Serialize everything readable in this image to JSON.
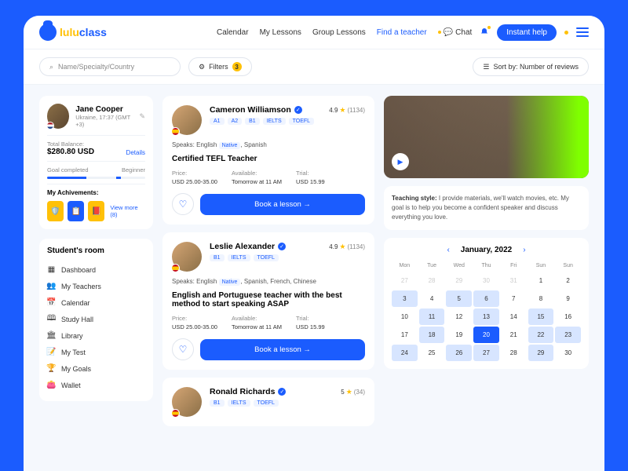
{
  "logo": {
    "part1": "lulu",
    "part2": "class"
  },
  "nav": [
    "Calendar",
    "My Lessons",
    "Group Lessons",
    "Find a teacher"
  ],
  "nav_active": 3,
  "chat_label": "Chat",
  "help_label": "Instant help",
  "search": {
    "placeholder": "Name/Specialty/Country"
  },
  "filters": {
    "label": "Filters",
    "count": "3"
  },
  "sort": {
    "label": "Sort by: Number of reviews"
  },
  "profile": {
    "name": "Jane Cooper",
    "location": "Ukraine, 17:37 (GMT +3)",
    "balance_label": "Total Balance:",
    "balance": "$280.80 USD",
    "details": "Details",
    "goal_label": "Goal completed",
    "goal_level": "Beginner",
    "ach_label": "My Achivements:",
    "viewmore": "View more (8)"
  },
  "menu": {
    "title": "Student's room",
    "items": [
      "Dashboard",
      "My Teachers",
      "Calendar",
      "Study Hall",
      "Library",
      "My Test",
      "My Goals",
      "Wallet"
    ]
  },
  "teachers": [
    {
      "name": "Cameron Williamson",
      "rating": "4.9",
      "reviews": "(1134)",
      "tags": [
        "A1",
        "A2",
        "B1",
        "IELTS",
        "TOEFL"
      ],
      "speaks_label": "Speaks:",
      "speaks": "English",
      "native": "Native",
      "speaks2": ", Spanish",
      "title": "Certified TEFL Teacher",
      "price_label": "Price:",
      "price": "USD 25.00-35.00",
      "avail_label": "Available:",
      "avail": "Tomorrow at 11 AM",
      "trial_label": "Trial:",
      "trial": "USD 15.99",
      "book": "Book a lesson →"
    },
    {
      "name": "Leslie Alexander",
      "rating": "4.9",
      "reviews": "(1134)",
      "tags": [
        "B1",
        "IELTS",
        "TOEFL"
      ],
      "speaks_label": "Speaks:",
      "speaks": "English",
      "native": "Native",
      "speaks2": ", Spanish, French, Chinese",
      "title": "English and Portuguese teacher with the best method to start speaking ASAP",
      "price_label": "Price:",
      "price": "USD 25.00-35.00",
      "avail_label": "Available:",
      "avail": "Tomorrow at 11 AM",
      "trial_label": "Trial:",
      "trial": "USD 15.99",
      "book": "Book a lesson →"
    },
    {
      "name": "Ronald Richards",
      "rating": "5",
      "reviews": "(34)",
      "tags": [
        "B1",
        "IELTS",
        "TOEFL"
      ]
    }
  ],
  "teaching": {
    "label": "Teaching style:",
    "text": " I provide materials, we'll watch movies, etc. My goal is to help you become a confident speaker and discuss everything you love."
  },
  "calendar": {
    "month": "January, 2022",
    "dow": [
      "Mon",
      "Tue",
      "Wed",
      "Thu",
      "Fri",
      "Sun",
      "Sun"
    ],
    "cells": [
      {
        "d": "27",
        "c": "other"
      },
      {
        "d": "28",
        "c": "other"
      },
      {
        "d": "29",
        "c": "other"
      },
      {
        "d": "30",
        "c": "other"
      },
      {
        "d": "31",
        "c": "other"
      },
      {
        "d": "1",
        "c": ""
      },
      {
        "d": "2",
        "c": ""
      },
      {
        "d": "3",
        "c": "avail"
      },
      {
        "d": "4",
        "c": ""
      },
      {
        "d": "5",
        "c": "avail"
      },
      {
        "d": "6",
        "c": "avail"
      },
      {
        "d": "7",
        "c": ""
      },
      {
        "d": "8",
        "c": ""
      },
      {
        "d": "9",
        "c": ""
      },
      {
        "d": "10",
        "c": ""
      },
      {
        "d": "11",
        "c": "avail"
      },
      {
        "d": "12",
        "c": ""
      },
      {
        "d": "13",
        "c": "avail"
      },
      {
        "d": "14",
        "c": ""
      },
      {
        "d": "15",
        "c": "avail"
      },
      {
        "d": "16",
        "c": ""
      },
      {
        "d": "17",
        "c": ""
      },
      {
        "d": "18",
        "c": "avail"
      },
      {
        "d": "19",
        "c": ""
      },
      {
        "d": "20",
        "c": "selected"
      },
      {
        "d": "21",
        "c": ""
      },
      {
        "d": "22",
        "c": "avail"
      },
      {
        "d": "23",
        "c": "avail"
      },
      {
        "d": "24",
        "c": "avail"
      },
      {
        "d": "25",
        "c": ""
      },
      {
        "d": "26",
        "c": "avail"
      },
      {
        "d": "27",
        "c": "avail"
      },
      {
        "d": "28",
        "c": ""
      },
      {
        "d": "29",
        "c": "avail"
      },
      {
        "d": "30",
        "c": ""
      }
    ]
  }
}
